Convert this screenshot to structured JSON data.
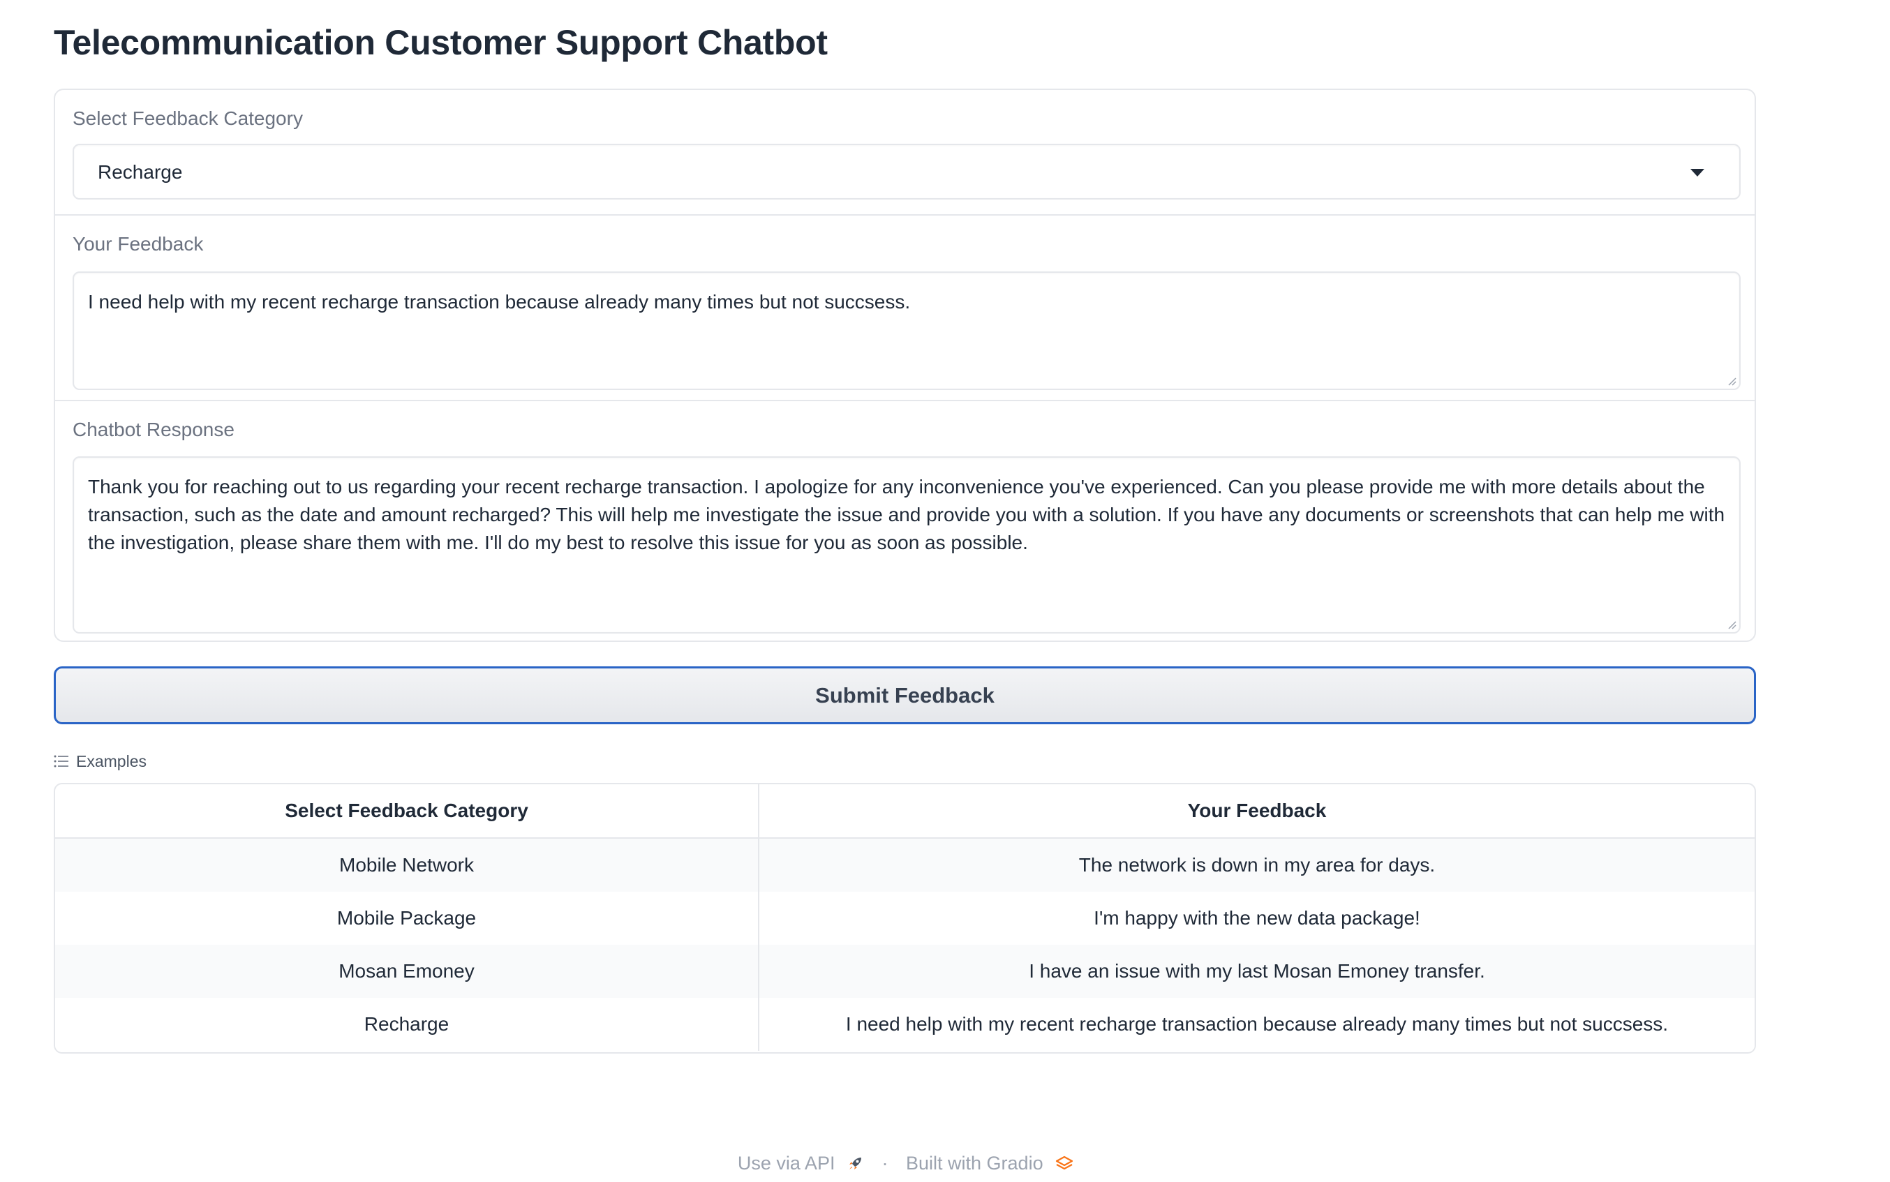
{
  "app": {
    "title": "Telecommunication Customer Support Chatbot"
  },
  "category": {
    "label": "Select Feedback Category",
    "value": "Recharge",
    "icon": "chevron-down-icon"
  },
  "feedback": {
    "label": "Your Feedback",
    "value": "I need help with my recent recharge transaction because already many times but not succsess."
  },
  "response": {
    "label": "Chatbot Response",
    "value": "Thank you for reaching out to us regarding your recent recharge transaction. I apologize for any inconvenience you've experienced. Can you please provide me with more details about the transaction, such as the date and amount recharged? This will help me investigate the issue and provide you with a solution. If you have any documents or screenshots that can help me with the investigation, please share them with me. I'll do my best to resolve this issue for you as soon as possible."
  },
  "submit": {
    "label": "Submit Feedback",
    "border_color": "#2a64c6"
  },
  "examples": {
    "title": "Examples",
    "icon": "list-icon",
    "headers": [
      "Select Feedback Category",
      "Your Feedback"
    ],
    "rows": [
      [
        "Mobile Network",
        "The network is down in my area for days."
      ],
      [
        "Mobile Package",
        "I'm happy with the new data package!"
      ],
      [
        "Mosan Emoney",
        "I have an issue with my last Mosan Emoney transfer."
      ],
      [
        "Recharge",
        "I need help with my recent recharge transaction because already many times but not succsess."
      ]
    ]
  },
  "footer": {
    "api_label": "Use via API",
    "api_icon": "rocket-icon",
    "separator": "·",
    "built_label": "Built with Gradio",
    "built_icon": "gradio-logo-icon",
    "accent": "#f97316"
  }
}
